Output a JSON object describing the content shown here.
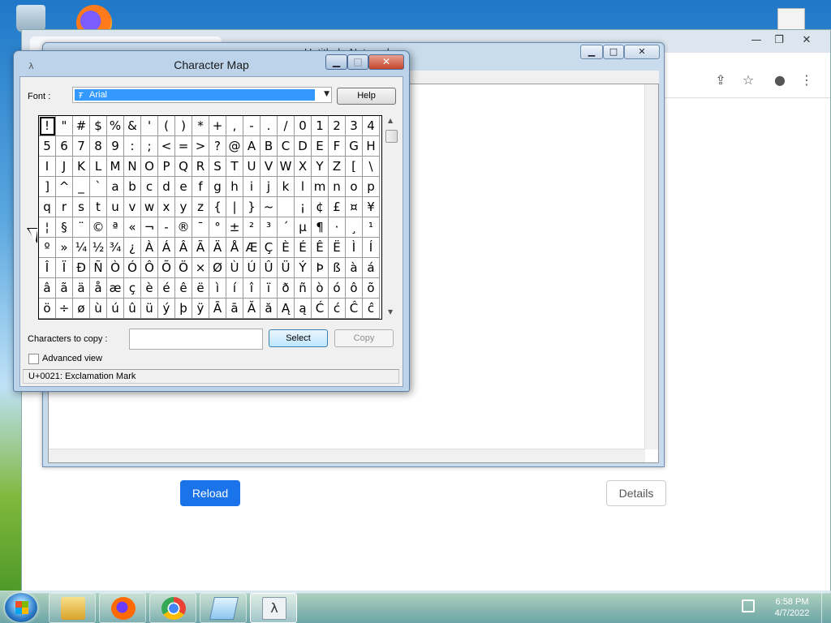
{
  "chrome": {
    "reload_label": "Reload",
    "details_label": "Details"
  },
  "notepad": {
    "title": "Untitled - Notepad"
  },
  "charmap": {
    "title": "Character Map",
    "font_label": "Font :",
    "font_value": "Arial",
    "help_label": "Help",
    "chars_to_copy_label": "Characters to copy :",
    "chars_to_copy_value": "",
    "select_label": "Select",
    "copy_label": "Copy",
    "advanced_view_label": "Advanced view",
    "advanced_view_checked": false,
    "status": "U+0021: Exclamation Mark",
    "selected_index": 0,
    "rows": [
      [
        "!",
        "\"",
        "#",
        "$",
        "%",
        "&",
        "'",
        "(",
        ")",
        "*",
        "+",
        ",",
        "-",
        ".",
        "/",
        "0",
        "1",
        "2",
        "3",
        "4"
      ],
      [
        "5",
        "6",
        "7",
        "8",
        "9",
        ":",
        ";",
        "<",
        "=",
        ">",
        "?",
        "@",
        "A",
        "B",
        "C",
        "D",
        "E",
        "F",
        "G",
        "H"
      ],
      [
        "I",
        "J",
        "K",
        "L",
        "M",
        "N",
        "O",
        "P",
        "Q",
        "R",
        "S",
        "T",
        "U",
        "V",
        "W",
        "X",
        "Y",
        "Z",
        "[",
        "\\"
      ],
      [
        "]",
        "^",
        "_",
        "`",
        "a",
        "b",
        "c",
        "d",
        "e",
        "f",
        "g",
        "h",
        "i",
        "j",
        "k",
        "l",
        "m",
        "n",
        "o",
        "p"
      ],
      [
        "q",
        "r",
        "s",
        "t",
        "u",
        "v",
        "w",
        "x",
        "y",
        "z",
        "{",
        "|",
        "}",
        "~",
        " ",
        "¡",
        "¢",
        "£",
        "¤",
        "¥"
      ],
      [
        "¦",
        "§",
        "¨",
        "©",
        "ª",
        "«",
        "¬",
        "-",
        "®",
        "¯",
        "°",
        "±",
        "²",
        "³",
        "´",
        "µ",
        "¶",
        "·",
        "¸",
        "¹"
      ],
      [
        "º",
        "»",
        "¼",
        "½",
        "¾",
        "¿",
        "À",
        "Á",
        "Â",
        "Ã",
        "Ä",
        "Å",
        "Æ",
        "Ç",
        "È",
        "É",
        "Ê",
        "Ë",
        "Ì",
        "Í"
      ],
      [
        "Î",
        "Ï",
        "Ð",
        "Ñ",
        "Ò",
        "Ó",
        "Ô",
        "Õ",
        "Ö",
        "×",
        "Ø",
        "Ù",
        "Ú",
        "Û",
        "Ü",
        "Ý",
        "Þ",
        "ß",
        "à",
        "á"
      ],
      [
        "â",
        "ã",
        "ä",
        "å",
        "æ",
        "ç",
        "è",
        "é",
        "ê",
        "ë",
        "ì",
        "í",
        "î",
        "ï",
        "ð",
        "ñ",
        "ò",
        "ó",
        "ô",
        "õ"
      ],
      [
        "ö",
        "÷",
        "ø",
        "ù",
        "ú",
        "û",
        "ü",
        "ý",
        "þ",
        "ÿ",
        "Ā",
        "ā",
        "Ă",
        "ă",
        "Ą",
        "ą",
        "Ć",
        "ć",
        "Ĉ",
        "ĉ"
      ]
    ]
  },
  "taskbar": {
    "time": "6:58 PM",
    "date": "4/7/2022",
    "apps": [
      {
        "name": "file-explorer-icon"
      },
      {
        "name": "firefox-icon"
      },
      {
        "name": "chrome-icon"
      },
      {
        "name": "notepad-icon"
      },
      {
        "name": "character-map-icon"
      }
    ]
  }
}
